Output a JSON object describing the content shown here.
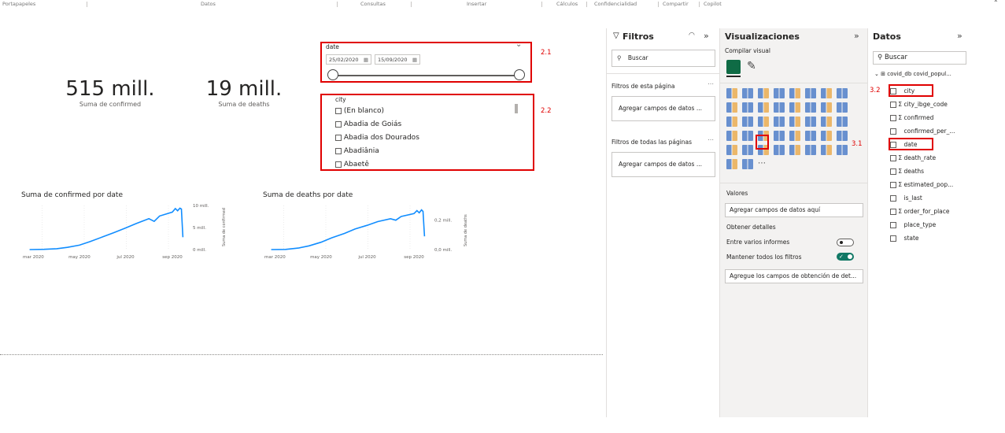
{
  "ribbon": {
    "groups": [
      "Portapapeles",
      "Datos",
      "Consultas",
      "Insertar",
      "Cálculos",
      "Confidencialidad",
      "Compartir",
      "Copilot"
    ]
  },
  "cards": [
    {
      "value": "515 mill.",
      "label": "Suma de confirmed"
    },
    {
      "value": "19 mill.",
      "label": "Suma de deaths"
    }
  ],
  "date_slicer": {
    "title": "date",
    "start": "25/02/2020",
    "end": "15/09/2020"
  },
  "city_slicer": {
    "title": "city",
    "items": [
      "(En blanco)",
      "Abadia de Goiás",
      "Abadia dos Dourados",
      "Abadiânia",
      "Abaetê"
    ]
  },
  "annotations": {
    "a21": "2.1",
    "a22": "2.2",
    "a31": "3.1",
    "a32": "3.2"
  },
  "chart_data": [
    {
      "type": "line",
      "title": "Suma de confirmed por date",
      "xlabel": "",
      "ylabel": "Suma de confirmed",
      "x_ticks": [
        "mar 2020",
        "may 2020",
        "jul 2020",
        "sep 2020"
      ],
      "y_ticks": [
        "0 mill.",
        "5 mill.",
        "10 mill."
      ],
      "ylim": [
        0,
        10
      ],
      "x": [
        "2020-02-25",
        "2020-03-15",
        "2020-04-01",
        "2020-04-15",
        "2020-05-01",
        "2020-05-15",
        "2020-06-01",
        "2020-06-15",
        "2020-07-01",
        "2020-07-15",
        "2020-08-01",
        "2020-08-08",
        "2020-08-15",
        "2020-09-01",
        "2020-09-05",
        "2020-09-08",
        "2020-09-11",
        "2020-09-13",
        "2020-09-15"
      ],
      "series": [
        {
          "values": [
            0,
            0.05,
            0.2,
            0.5,
            1.0,
            1.8,
            2.9,
            3.8,
            4.9,
            5.9,
            7.0,
            6.4,
            7.6,
            8.5,
            9.3,
            8.8,
            9.4,
            9.2,
            2.8
          ]
        }
      ],
      "color": "#118dff"
    },
    {
      "type": "line",
      "title": "Suma de deaths por date",
      "xlabel": "",
      "ylabel": "Suma de deaths",
      "x_ticks": [
        "mar 2020",
        "may 2020",
        "jul 2020",
        "sep 2020"
      ],
      "y_ticks": [
        "0,0 mill.",
        "0,2 mill."
      ],
      "ylim": [
        0,
        0.3
      ],
      "x": [
        "2020-02-25",
        "2020-03-15",
        "2020-04-01",
        "2020-04-15",
        "2020-05-01",
        "2020-05-15",
        "2020-06-01",
        "2020-06-15",
        "2020-07-01",
        "2020-07-15",
        "2020-08-01",
        "2020-08-08",
        "2020-08-15",
        "2020-09-01",
        "2020-09-05",
        "2020-09-08",
        "2020-09-11",
        "2020-09-13",
        "2020-09-15"
      ],
      "series": [
        {
          "values": [
            0,
            0.001,
            0.01,
            0.025,
            0.05,
            0.08,
            0.11,
            0.14,
            0.165,
            0.19,
            0.21,
            0.2,
            0.225,
            0.245,
            0.265,
            0.25,
            0.27,
            0.26,
            0.09
          ]
        }
      ],
      "color": "#118dff"
    }
  ],
  "filters_pane": {
    "title": "Filtros",
    "search_placeholder": "Buscar",
    "page_section": "Filtros de esta página",
    "page_drop": "Agregar campos de datos ...",
    "all_section": "Filtros de todas las páginas",
    "all_drop": "Agregar campos de datos ..."
  },
  "viz_pane": {
    "title": "Visualizaciones",
    "build_label": "Compilar visual",
    "values_label": "Valores",
    "values_drop": "Agregar campos de datos aquí",
    "drill_label": "Obtener detalles",
    "cross_report": "Entre varios informes",
    "keep_filters": "Mantener todos los filtros",
    "drill_drop": "Agregue los campos de obtención de det..."
  },
  "data_pane": {
    "title": "Datos",
    "search_placeholder": "Buscar",
    "table_name": "covid_db covid_popul...",
    "fields": [
      {
        "name": "city",
        "sigma": false
      },
      {
        "name": "city_ibge_code",
        "sigma": true
      },
      {
        "name": "confirmed",
        "sigma": true
      },
      {
        "name": "confirmed_per_...",
        "sigma": false
      },
      {
        "name": "date",
        "sigma": false
      },
      {
        "name": "death_rate",
        "sigma": true
      },
      {
        "name": "deaths",
        "sigma": true
      },
      {
        "name": "estimated_pop...",
        "sigma": true
      },
      {
        "name": "is_last",
        "sigma": false
      },
      {
        "name": "order_for_place",
        "sigma": true
      },
      {
        "name": "place_type",
        "sigma": false
      },
      {
        "name": "state",
        "sigma": false
      }
    ]
  },
  "colors": {
    "accent_line": "#118dff",
    "annotation_red": "#e00000",
    "toggle_on": "#117865"
  }
}
